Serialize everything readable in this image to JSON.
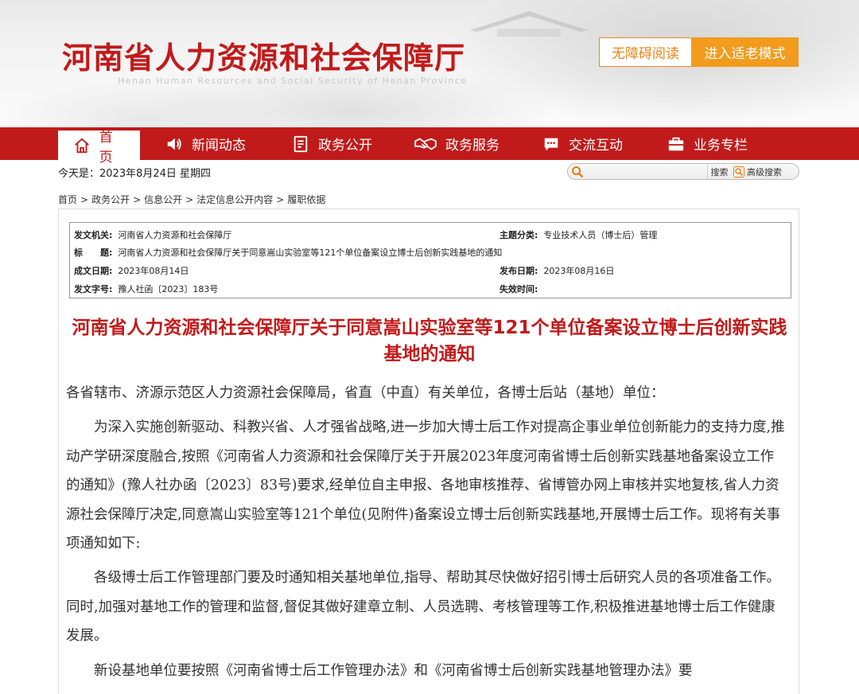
{
  "header": {
    "site_title": "河南省人力资源和社会保障厅",
    "site_subtitle": "Henan Human Resources and Social Security of Henan Province",
    "accessibility_button": "无障碍阅读",
    "elder_mode_button": "进入适老模式"
  },
  "nav": {
    "items": [
      {
        "label": "首页",
        "icon": "home-icon"
      },
      {
        "label": "新闻动态",
        "icon": "speaker-icon"
      },
      {
        "label": "政务公开",
        "icon": "document-icon"
      },
      {
        "label": "政务服务",
        "icon": "handshake-icon"
      },
      {
        "label": "交流互动",
        "icon": "chat-icon"
      },
      {
        "label": "业务专栏",
        "icon": "briefcase-icon"
      }
    ]
  },
  "toolbar": {
    "today": "今天是：2023年8月24日 星期四",
    "search_placeholder": "",
    "search_button": "搜索",
    "advanced_search": "高级搜索"
  },
  "breadcrumb": [
    "首页",
    ">",
    "政务公开",
    ">",
    "信息公开",
    ">",
    "法定信息公开内容",
    ">",
    "履职依据"
  ],
  "meta": {
    "issuer_label": "发文机关:",
    "issuer": "河南省人力资源和社会保障厅",
    "topic_label": "主题分类:",
    "topic": "专业技术人员（博士后）管理",
    "title_label": "标　　题:",
    "title": "河南省人力资源和社会保障厅关于同意嵩山实验室等121个单位备案设立博士后创新实践基地的通知",
    "created_label": "成文日期:",
    "created": "2023年08月14日",
    "published_label": "发布日期:",
    "published": "2023年08月16日",
    "doc_no_label": "发文字号:",
    "doc_no": "豫人社函〔2023〕183号",
    "expire_label": "失效时间:",
    "expire": ""
  },
  "article": {
    "title": "河南省人力资源和社会保障厅关于同意嵩山实验室等121个单位备案设立博士后创新实践基地的通知",
    "salutation": "各省辖市、济源示范区人力资源社会保障局，省直（中直）有关单位，各博士后站（基地）单位：",
    "paragraphs": [
      "为深入实施创新驱动、科教兴省、人才强省战略,进一步加大博士后工作对提高企事业单位创新能力的支持力度,推动产学研深度融合,按照《河南省人力资源和社会保障厅关于开展2023年度河南省博士后创新实践基地备案设立工作的通知》(豫人社办函〔2023〕83号)要求,经单位自主申报、各地审核推荐、省博管办网上审核并实地复核,省人力资源社会保障厅决定,同意嵩山实验室等121个单位(见附件)备案设立博士后创新实践基地,开展博士后工作。现将有关事项通知如下:",
      "各级博士后工作管理部门要及时通知相关基地单位,指导、帮助其尽快做好招引博士后研究人员的各项准备工作。同时,加强对基地工作的管理和监督,督促其做好建章立制、人员选聘、考核管理等工作,积极推进基地博士后工作健康发展。",
      "新设基地单位要按照《河南省博士后工作管理办法》和《河南省博士后创新实践基地管理办法》要"
    ]
  },
  "colors": {
    "brand_red": "#c11a1a",
    "accent_orange": "#f29b1d"
  }
}
